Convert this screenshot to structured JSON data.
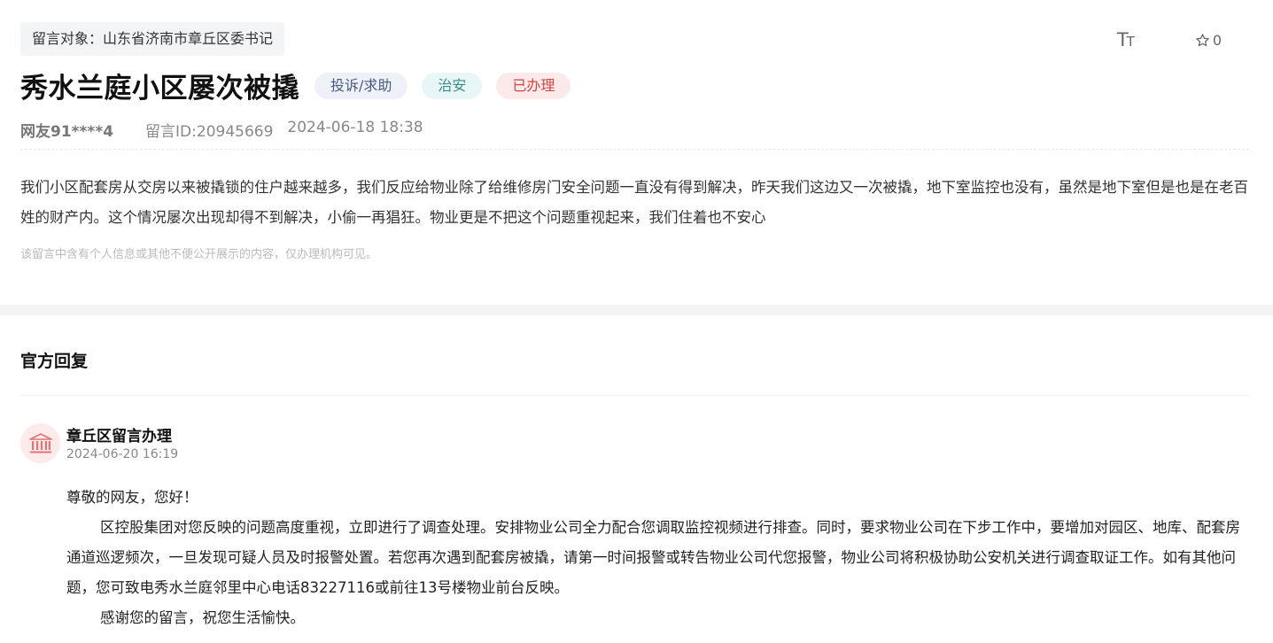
{
  "header": {
    "target_label": "留言对象：山东省济南市章丘区委书记",
    "font_tool_big": "T",
    "font_tool_small": "T",
    "favorite_count": "0"
  },
  "message": {
    "title": "秀水兰庭小区屡次被撬",
    "tags": [
      "投诉/求助",
      "治安",
      "已办理"
    ],
    "tag_colors": [
      "#4a5a7f",
      "#3a8c8a",
      "#d04646"
    ],
    "user": "网友91****4",
    "message_id": "留言ID:20945669",
    "datetime": "2024-06-18 18:38",
    "content": "我们小区配套房从交房以来被撬锁的住户越来越多，我们反应给物业除了给维修房门安全问题一直没有得到解决，昨天我们这边又一次被撬，地下室监控也没有，虽然是地下室但是也是在老百姓的财产内。这个情况屡次出现却得不到解决，小偷一再猖狂。物业更是不把这个问题重视起来，我们住着也不安心",
    "privacy_notice": "该留言中含有个人信息或其他不便公开展示的内容，仅办理机构可见。"
  },
  "reply": {
    "section_title": "官方回复",
    "org_name": "章丘区留言办理",
    "datetime": "2024-06-20 16:19",
    "icon": "government-building-icon",
    "paragraphs": [
      "尊敬的网友，您好！",
      "区控股集团对您反映的问题高度重视，立即进行了调查处理。安排物业公司全力配合您调取监控视频进行排查。同时，要求物业公司在下步工作中，要增加对园区、地库、配套房通道巡逻频次，一旦发现可疑人员及时报警处置。若您再次遇到配套房被撬，请第一时间报警或转告物业公司代您报警，物业公司将积极协助公安机关进行调查取证工作。如有其他问题，您可致电秀水兰庭邻里中心电话83227116或前往13号楼物业前台反映。",
      "感谢您的留言，祝您生活愉快。"
    ]
  }
}
